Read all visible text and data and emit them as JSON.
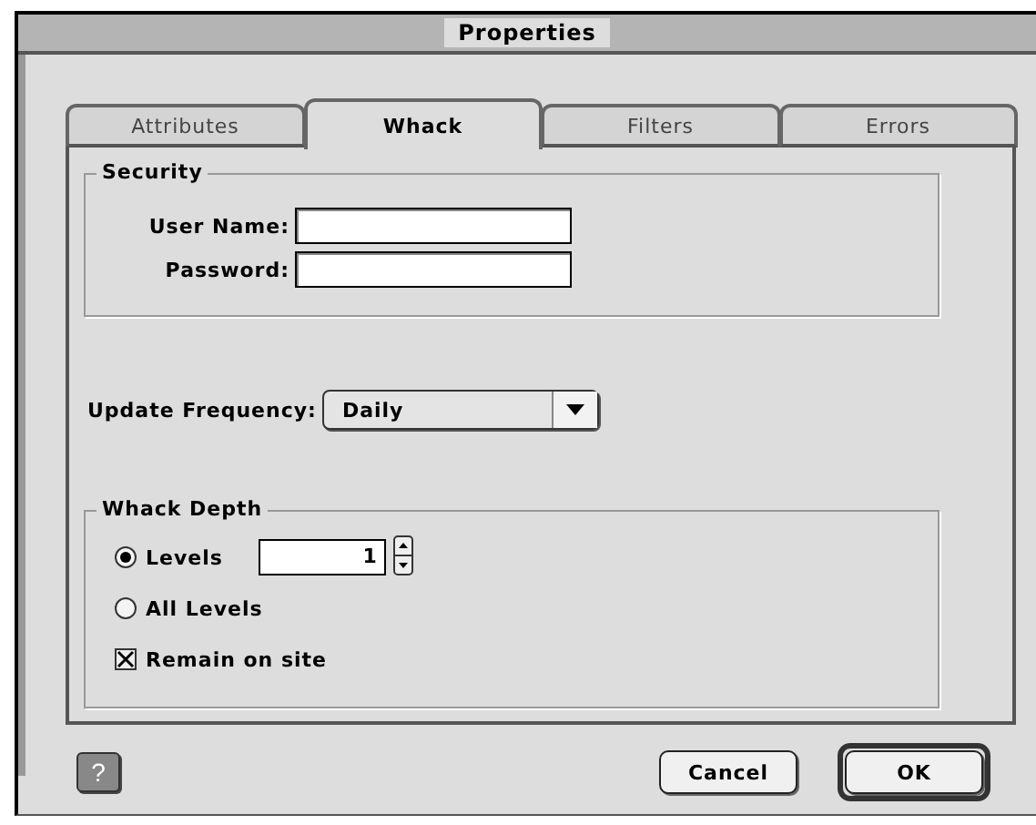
{
  "window": {
    "title": "Properties"
  },
  "tabs": [
    {
      "label": "Attributes",
      "selected": false
    },
    {
      "label": "Whack",
      "selected": true
    },
    {
      "label": "Filters",
      "selected": false
    },
    {
      "label": "Errors",
      "selected": false
    }
  ],
  "security": {
    "title": "Security",
    "fields": [
      {
        "label": "User Name:"
      },
      {
        "label": "Password:"
      }
    ]
  },
  "update_frequency": {
    "label": "Update Frequency:",
    "value": "Daily"
  },
  "whack_depth": {
    "title": "Whack Depth",
    "options": [
      {
        "kind": "radio",
        "label": "Levels",
        "selected": true,
        "value": "1"
      },
      {
        "kind": "radio",
        "label": "All Levels",
        "selected": false
      },
      {
        "kind": "checkbox",
        "label": "Remain on site",
        "checked": true
      }
    ]
  },
  "help_button": {
    "label": "?"
  },
  "buttons": [
    {
      "label": "Cancel",
      "default": false
    },
    {
      "label": "OK",
      "default": true
    }
  ]
}
